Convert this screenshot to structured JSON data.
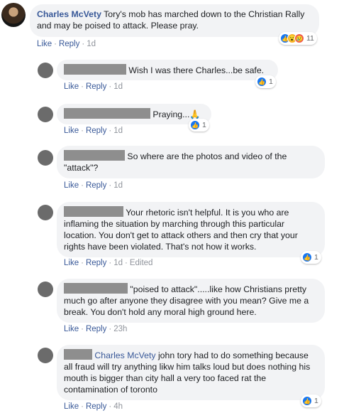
{
  "main_comment": {
    "author": "Charles McVety",
    "text": "Tory's mob has marched down to the Christian Rally and may be poised to attack. Please pray.",
    "actions": {
      "like": "Like",
      "reply": "Reply",
      "time": "1d"
    },
    "reactions": {
      "types": [
        "like-icon",
        "wow-icon",
        "sad-icon"
      ],
      "count": "11"
    }
  },
  "replies": [
    {
      "text": "Wish I was there Charles...be safe.",
      "actions": {
        "like": "Like",
        "reply": "Reply",
        "time": "1d"
      },
      "reactions": {
        "count": "1"
      }
    },
    {
      "text": "Praying...🙏",
      "actions": {
        "like": "Like",
        "reply": "Reply",
        "time": "1d"
      },
      "reactions": {
        "count": "1"
      }
    },
    {
      "text": "So where are the photos and video of the \"attack\"?",
      "actions": {
        "like": "Like",
        "reply": "Reply",
        "time": "1d"
      }
    },
    {
      "text": "Your rhetoric isn't helpful. It is you who are inflaming the situation by marching through this particular location. You don't get to attack others and then cry that your rights have been violated. That's not how it works.",
      "actions": {
        "like": "Like",
        "reply": "Reply",
        "time": "1d",
        "edited": "Edited"
      },
      "reactions": {
        "count": "1"
      }
    },
    {
      "text": "\"poised to attack\".....like how Christians pretty much go after anyone they disagree with you mean? Give me a break. You don't hold any moral high ground here.",
      "actions": {
        "like": "Like",
        "reply": "Reply",
        "time": "23h"
      }
    },
    {
      "mention": "Charles McVety",
      "text": " john tory had to do something because all fraud will try anything likw him talks loud but does nothing his mouth is bigger than city hall a very too faced rat the contamination of toronto",
      "actions": {
        "like": "Like",
        "reply": "Reply",
        "time": "4h"
      },
      "reactions": {
        "count": "1"
      }
    }
  ],
  "colors": {
    "link": "#385898",
    "bubble": "#f2f3f5",
    "like": "#1877f2"
  }
}
